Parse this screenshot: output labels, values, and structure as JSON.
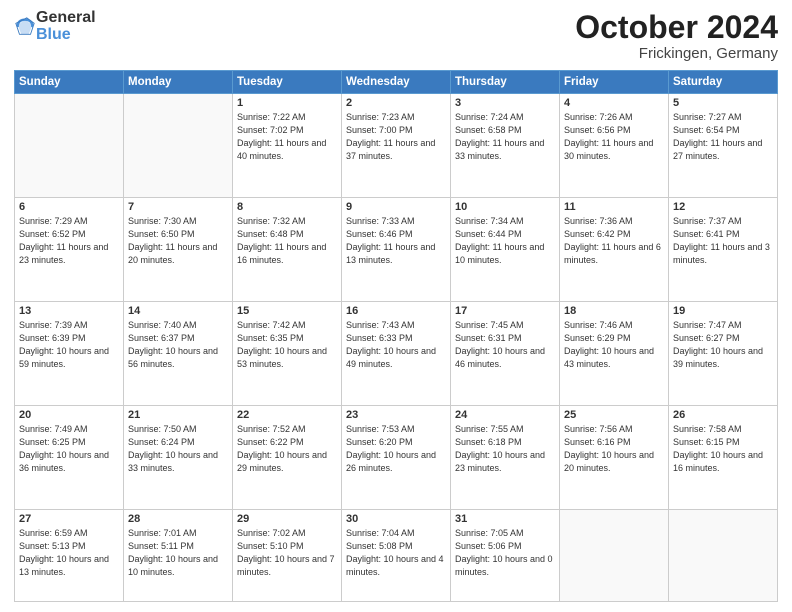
{
  "header": {
    "logo_general": "General",
    "logo_blue": "Blue",
    "month_title": "October 2024",
    "location": "Frickingen, Germany"
  },
  "weekdays": [
    "Sunday",
    "Monday",
    "Tuesday",
    "Wednesday",
    "Thursday",
    "Friday",
    "Saturday"
  ],
  "weeks": [
    [
      {
        "day": "",
        "info": ""
      },
      {
        "day": "",
        "info": ""
      },
      {
        "day": "1",
        "info": "Sunrise: 7:22 AM\nSunset: 7:02 PM\nDaylight: 11 hours and 40 minutes."
      },
      {
        "day": "2",
        "info": "Sunrise: 7:23 AM\nSunset: 7:00 PM\nDaylight: 11 hours and 37 minutes."
      },
      {
        "day": "3",
        "info": "Sunrise: 7:24 AM\nSunset: 6:58 PM\nDaylight: 11 hours and 33 minutes."
      },
      {
        "day": "4",
        "info": "Sunrise: 7:26 AM\nSunset: 6:56 PM\nDaylight: 11 hours and 30 minutes."
      },
      {
        "day": "5",
        "info": "Sunrise: 7:27 AM\nSunset: 6:54 PM\nDaylight: 11 hours and 27 minutes."
      }
    ],
    [
      {
        "day": "6",
        "info": "Sunrise: 7:29 AM\nSunset: 6:52 PM\nDaylight: 11 hours and 23 minutes."
      },
      {
        "day": "7",
        "info": "Sunrise: 7:30 AM\nSunset: 6:50 PM\nDaylight: 11 hours and 20 minutes."
      },
      {
        "day": "8",
        "info": "Sunrise: 7:32 AM\nSunset: 6:48 PM\nDaylight: 11 hours and 16 minutes."
      },
      {
        "day": "9",
        "info": "Sunrise: 7:33 AM\nSunset: 6:46 PM\nDaylight: 11 hours and 13 minutes."
      },
      {
        "day": "10",
        "info": "Sunrise: 7:34 AM\nSunset: 6:44 PM\nDaylight: 11 hours and 10 minutes."
      },
      {
        "day": "11",
        "info": "Sunrise: 7:36 AM\nSunset: 6:42 PM\nDaylight: 11 hours and 6 minutes."
      },
      {
        "day": "12",
        "info": "Sunrise: 7:37 AM\nSunset: 6:41 PM\nDaylight: 11 hours and 3 minutes."
      }
    ],
    [
      {
        "day": "13",
        "info": "Sunrise: 7:39 AM\nSunset: 6:39 PM\nDaylight: 10 hours and 59 minutes."
      },
      {
        "day": "14",
        "info": "Sunrise: 7:40 AM\nSunset: 6:37 PM\nDaylight: 10 hours and 56 minutes."
      },
      {
        "day": "15",
        "info": "Sunrise: 7:42 AM\nSunset: 6:35 PM\nDaylight: 10 hours and 53 minutes."
      },
      {
        "day": "16",
        "info": "Sunrise: 7:43 AM\nSunset: 6:33 PM\nDaylight: 10 hours and 49 minutes."
      },
      {
        "day": "17",
        "info": "Sunrise: 7:45 AM\nSunset: 6:31 PM\nDaylight: 10 hours and 46 minutes."
      },
      {
        "day": "18",
        "info": "Sunrise: 7:46 AM\nSunset: 6:29 PM\nDaylight: 10 hours and 43 minutes."
      },
      {
        "day": "19",
        "info": "Sunrise: 7:47 AM\nSunset: 6:27 PM\nDaylight: 10 hours and 39 minutes."
      }
    ],
    [
      {
        "day": "20",
        "info": "Sunrise: 7:49 AM\nSunset: 6:25 PM\nDaylight: 10 hours and 36 minutes."
      },
      {
        "day": "21",
        "info": "Sunrise: 7:50 AM\nSunset: 6:24 PM\nDaylight: 10 hours and 33 minutes."
      },
      {
        "day": "22",
        "info": "Sunrise: 7:52 AM\nSunset: 6:22 PM\nDaylight: 10 hours and 29 minutes."
      },
      {
        "day": "23",
        "info": "Sunrise: 7:53 AM\nSunset: 6:20 PM\nDaylight: 10 hours and 26 minutes."
      },
      {
        "day": "24",
        "info": "Sunrise: 7:55 AM\nSunset: 6:18 PM\nDaylight: 10 hours and 23 minutes."
      },
      {
        "day": "25",
        "info": "Sunrise: 7:56 AM\nSunset: 6:16 PM\nDaylight: 10 hours and 20 minutes."
      },
      {
        "day": "26",
        "info": "Sunrise: 7:58 AM\nSunset: 6:15 PM\nDaylight: 10 hours and 16 minutes."
      }
    ],
    [
      {
        "day": "27",
        "info": "Sunrise: 6:59 AM\nSunset: 5:13 PM\nDaylight: 10 hours and 13 minutes."
      },
      {
        "day": "28",
        "info": "Sunrise: 7:01 AM\nSunset: 5:11 PM\nDaylight: 10 hours and 10 minutes."
      },
      {
        "day": "29",
        "info": "Sunrise: 7:02 AM\nSunset: 5:10 PM\nDaylight: 10 hours and 7 minutes."
      },
      {
        "day": "30",
        "info": "Sunrise: 7:04 AM\nSunset: 5:08 PM\nDaylight: 10 hours and 4 minutes."
      },
      {
        "day": "31",
        "info": "Sunrise: 7:05 AM\nSunset: 5:06 PM\nDaylight: 10 hours and 0 minutes."
      },
      {
        "day": "",
        "info": ""
      },
      {
        "day": "",
        "info": ""
      }
    ]
  ]
}
